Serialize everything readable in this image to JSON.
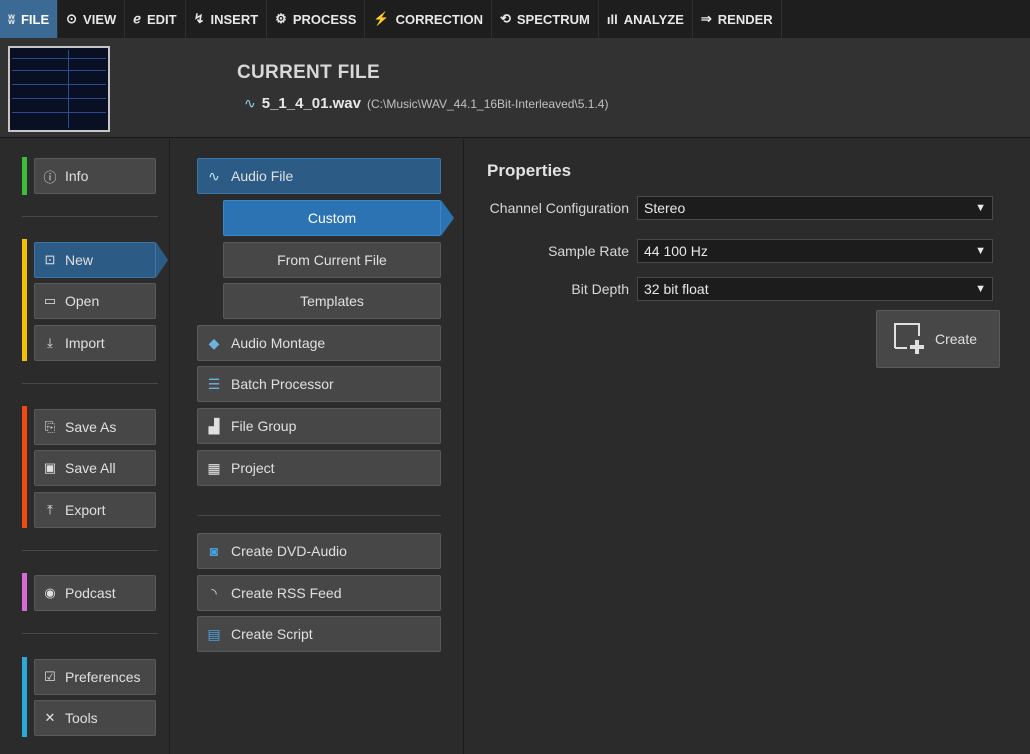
{
  "tabs": [
    {
      "icon": "ʬ",
      "label": "FILE",
      "active": true
    },
    {
      "icon": "⊙",
      "label": "VIEW"
    },
    {
      "icon": "ℯ",
      "label": "EDIT"
    },
    {
      "icon": "↯",
      "label": "INSERT"
    },
    {
      "icon": "⚙",
      "label": "PROCESS"
    },
    {
      "icon": "⚡",
      "label": "CORRECTION"
    },
    {
      "icon": "⟲",
      "label": "SPECTRUM"
    },
    {
      "icon": "ıll",
      "label": "ANALYZE"
    },
    {
      "icon": "⇒",
      "label": "RENDER"
    }
  ],
  "header": {
    "title": "CURRENT FILE",
    "file_name": "5_1_4_01.wav",
    "file_path": "(C:\\Music\\WAV_44.1_16Bit-Interleaved\\5.1.4)"
  },
  "left_nav": {
    "info": "Info",
    "new": "New",
    "open": "Open",
    "import": "Import",
    "save_as": "Save As",
    "save_all": "Save All",
    "export": "Export",
    "podcast": "Podcast",
    "preferences": "Preferences",
    "tools": "Tools"
  },
  "bar_colors": {
    "info": "#3bbf3b",
    "file": "#f2c200",
    "save": "#f04a12",
    "podcast": "#d66ad6",
    "settings": "#2aa8d8"
  },
  "new_menu": {
    "audio_file": "Audio File",
    "custom": "Custom",
    "from_current": "From Current File",
    "templates": "Templates",
    "audio_montage": "Audio Montage",
    "batch_processor": "Batch Processor",
    "file_group": "File Group",
    "project": "Project",
    "create_dvd": "Create DVD-Audio",
    "create_rss": "Create RSS Feed",
    "create_script": "Create Script"
  },
  "properties": {
    "title": "Properties",
    "channel_label": "Channel Configuration",
    "channel_value": "Stereo",
    "rate_label": "Sample Rate",
    "rate_value": "44 100 Hz",
    "depth_label": "Bit Depth",
    "depth_value": "32 bit float",
    "create_label": "Create"
  }
}
